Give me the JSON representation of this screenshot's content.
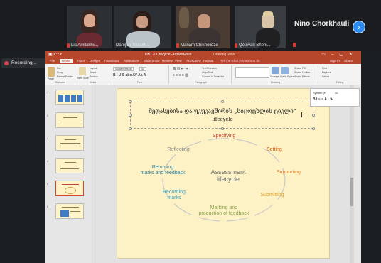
{
  "participants": [
    {
      "name": "Lia Amilakhv..."
    },
    {
      "name": "Darejan Tsotskh..."
    },
    {
      "name": "Mariam Chikhelidze"
    },
    {
      "name": "Qetevan Sheni..."
    }
  ],
  "active_speaker": "Nino Chorkhauli",
  "recording_label": "Recording...",
  "ppt": {
    "window_title": "DBT & Lifecycle - PowerPoint",
    "context_tab": "Drawing Tools",
    "tabs": [
      "File",
      "Home",
      "Insert",
      "Design",
      "Transitions",
      "Animations",
      "Slide Show",
      "Review",
      "View",
      "ACROBAT",
      "Format"
    ],
    "active_tab": "Home",
    "tell_me": "Tell me what you want to do",
    "signin": "Sign in",
    "share": "Share",
    "ribbon_groups": [
      "Clipboard",
      "Slides",
      "Font",
      "Paragraph",
      "Drawing",
      "Editing"
    ],
    "ribbon_labels": {
      "paste": "Paste",
      "cut": "Cut",
      "copy": "Copy",
      "format_painter": "Format Painter",
      "new_slide": "New Slide",
      "layout": "Layout",
      "reset": "Reset",
      "section": "Section",
      "font_name": "Sylfaen (Headi",
      "font_size": "40",
      "text_direction": "Text Direction",
      "align_text": "Align Text",
      "convert": "Convert to SmartArt",
      "arrange": "Arrange",
      "quick_styles": "Quick Styles",
      "shape_fill": "Shape Fill",
      "shape_outline": "Shape Outline",
      "shape_effects": "Shape Effects",
      "find": "Find",
      "replace": "Replace",
      "select": "Select"
    },
    "thumbnails": [
      {
        "num": "1"
      },
      {
        "num": "2"
      },
      {
        "num": "3"
      },
      {
        "num": "4"
      },
      {
        "num": "5"
      },
      {
        "num": "6"
      }
    ],
    "selected_thumb": 4,
    "slide": {
      "title_line1": "შეფასებისა და უკუკავშირის „სიცოცხლის ციკლი“",
      "title_line2": "lifecycle",
      "center": "Assessment\nlifecycle",
      "stages": [
        {
          "label": "Specifying",
          "color": "#c0392b"
        },
        {
          "label": "Setting",
          "color": "#d35400"
        },
        {
          "label": "Supporting",
          "color": "#e67e22"
        },
        {
          "label": "Submitting",
          "color": "#e2a226"
        },
        {
          "label": "Marking and\nproduction of feedback",
          "color": "#8aa04a"
        },
        {
          "label": "Recording\nmarks",
          "color": "#3aa3c4"
        },
        {
          "label": "Returning\nmarks and feedback",
          "color": "#2f7f9a"
        },
        {
          "label": "Reflecting",
          "color": "#8a8a8a"
        }
      ]
    },
    "mini_toolbar": {
      "font": "Sylfaen (H",
      "size": "40",
      "style": "Style",
      "fill": "Fill",
      "outline": "Outline"
    }
  },
  "colors": {
    "ppt_accent": "#b7472a",
    "slide_bg": "#fdf2c6",
    "cycle_line": "#b9b9b9"
  }
}
